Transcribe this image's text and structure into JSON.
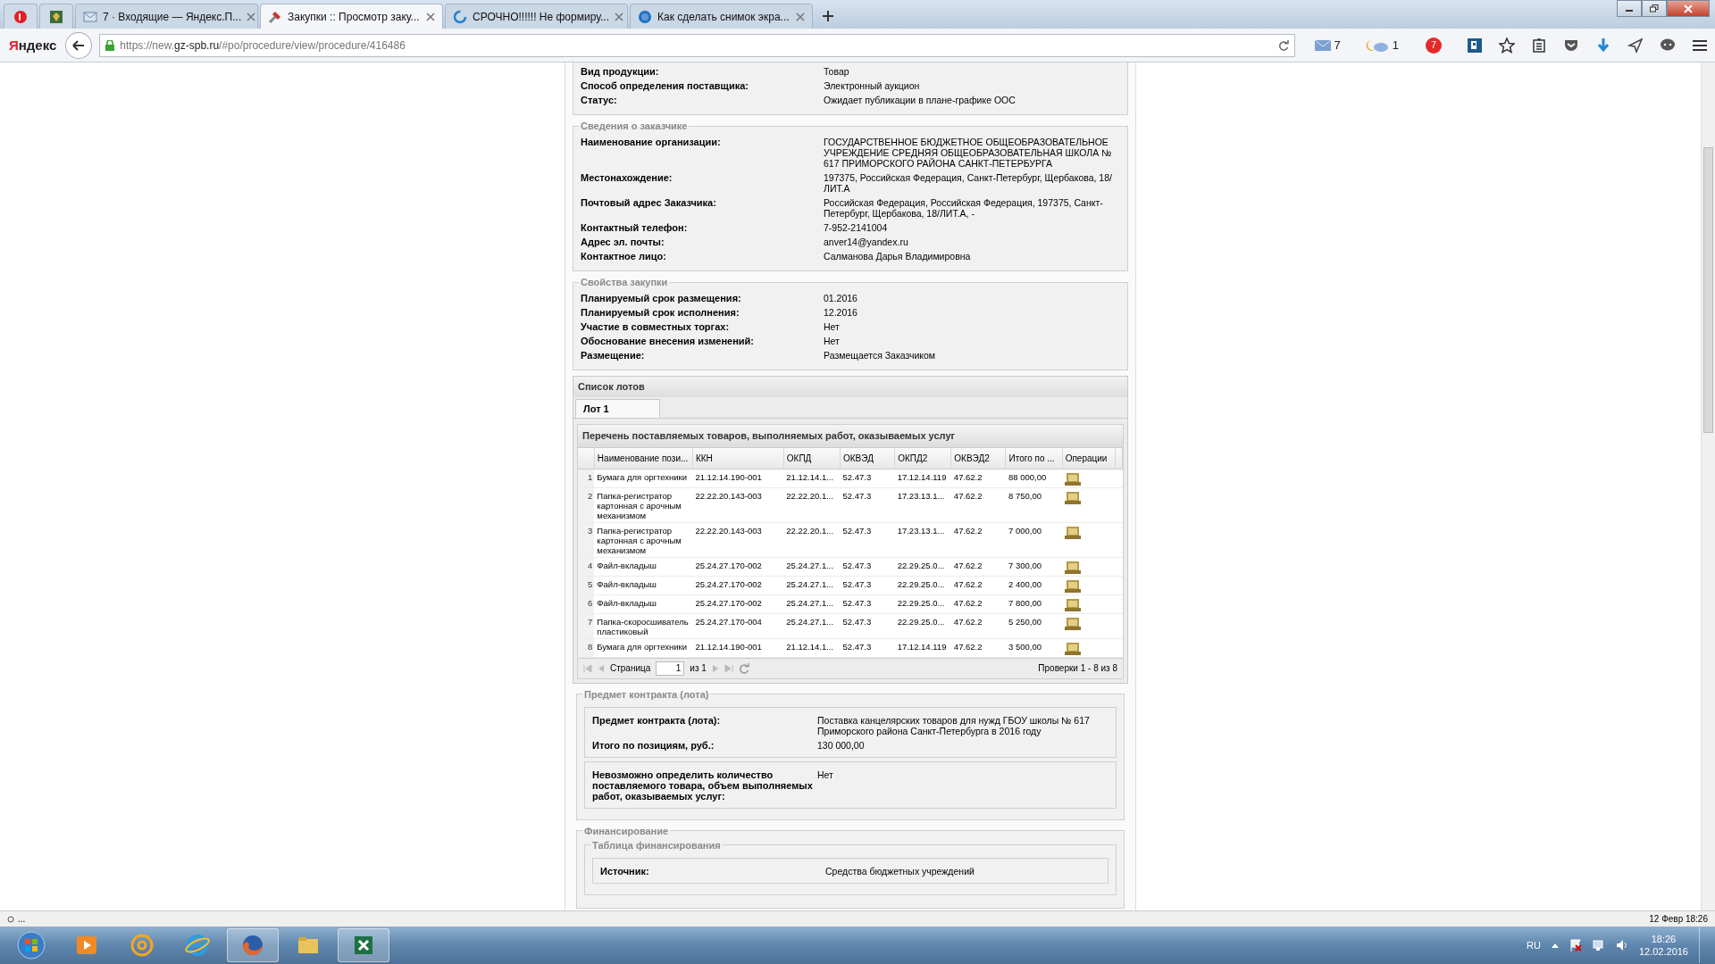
{
  "browser": {
    "tabs": [
      {
        "title": "7 · Входящие — Яндекс.П...",
        "selected": false
      },
      {
        "title": "Закупки :: Просмотр заку...",
        "selected": true
      },
      {
        "title": "СРОЧНО!!!!!! Не формиру...",
        "selected": false
      },
      {
        "title": "Как сделать снимок экра...",
        "selected": false
      }
    ],
    "logo": "Яндекс",
    "url_scheme": "https://new.",
    "url_domain": "gz-spb.ru",
    "url_path": "/#po/procedure/view/procedure/416486",
    "mail_count": "7",
    "weather_count": "1",
    "notify_badge": "7"
  },
  "procedure": {
    "rows": [
      {
        "label": "Вид продукции:",
        "value": "Товар"
      },
      {
        "label": "Способ определения поставщика:",
        "value": "Электронный аукцион"
      },
      {
        "label": "Статус:",
        "value": "Ожидает публикации в плане-графике ООС"
      }
    ]
  },
  "customer": {
    "legend": "Сведения о заказчике",
    "rows": [
      {
        "label": "Наименование организации:",
        "value": "ГОСУДАРСТВЕННОЕ БЮДЖЕТНОЕ ОБЩЕОБРАЗОВАТЕЛЬНОЕ УЧРЕЖДЕНИЕ СРЕДНЯЯ ОБЩЕОБРАЗОВАТЕЛЬНАЯ ШКОЛА № 617 ПРИМОРСКОГО РАЙОНА САНКТ-ПЕТЕРБУРГА"
      },
      {
        "label": "Местонахождение:",
        "value": "197375, Российская Федерация, Санкт-Петербург, Щербакова, 18/ЛИТ.А"
      },
      {
        "label": "Почтовый адрес Заказчика:",
        "value": "Российская Федерация, Российская Федерация, 197375, Санкт-Петербург, Щербакова, 18/ЛИТ.А, -"
      },
      {
        "label": "Контактный телефон:",
        "value": "7-952-2141004"
      },
      {
        "label": "Адрес эл. почты:",
        "value": "anver14@yandex.ru"
      },
      {
        "label": "Контактное лицо:",
        "value": "Салманова Дарья Владимировна"
      }
    ]
  },
  "properties": {
    "legend": "Свойства закупки",
    "rows": [
      {
        "label": "Планируемый срок размещения:",
        "value": "01.2016"
      },
      {
        "label": "Планируемый срок исполнения:",
        "value": "12.2016"
      },
      {
        "label": "Участие в совместных торгах:",
        "value": "Нет"
      },
      {
        "label": "Обоснование внесения изменений:",
        "value": "Нет"
      },
      {
        "label": "Размещение:",
        "value": "Размещается Заказчиком"
      }
    ]
  },
  "lots": {
    "title": "Список лотов",
    "tabs": [
      {
        "label": "Лот 1",
        "selected": true
      }
    ],
    "grid_title": "Перечень поставляемых товаров, выполняемых работ, оказываемых услуг",
    "columns": [
      "Наименование пози...",
      "ККН",
      "ОКПД",
      "ОКВЭД",
      "ОКПД2",
      "ОКВЭД2",
      "Итого по ...",
      "Операции"
    ],
    "rows": [
      {
        "number": "1",
        "cells": [
          "Бумага для оргтехники",
          "21.12.14.190-001",
          "21.12.14.1...",
          "52.47.3",
          "17.12.14.119",
          "47.62.2",
          "88 000,00"
        ]
      },
      {
        "number": "2",
        "cells": [
          "Папка-регистратор картонная с арочным механизмом",
          "22.22.20.143-003",
          "22.22.20.1...",
          "52.47.3",
          "17.23.13.1...",
          "47.62.2",
          "8 750,00"
        ]
      },
      {
        "number": "3",
        "cells": [
          "Папка-регистратор картонная с арочным механизмом",
          "22.22.20.143-003",
          "22.22.20.1...",
          "52.47.3",
          "17.23.13.1...",
          "47.62.2",
          "7 000,00"
        ]
      },
      {
        "number": "4",
        "cells": [
          "Файл-вкладыш",
          "25.24.27.170-002",
          "25.24.27.1...",
          "52.47.3",
          "22.29.25.0...",
          "47.62.2",
          "7 300,00"
        ]
      },
      {
        "number": "5",
        "cells": [
          "Файл-вкладыш",
          "25.24.27.170-002",
          "25.24.27.1...",
          "52.47.3",
          "22.29.25.0...",
          "47.62.2",
          "2 400,00"
        ]
      },
      {
        "number": "6",
        "cells": [
          "Файл-вкладыш",
          "25.24.27.170-002",
          "25.24.27.1...",
          "52.47.3",
          "22.29.25.0...",
          "47.62.2",
          "7 800,00"
        ]
      },
      {
        "number": "7",
        "cells": [
          "Папка-скоросшиватель пластиковый",
          "25.24.27.170-004",
          "25.24.27.1...",
          "52.47.3",
          "22.29.25.0...",
          "47.62.2",
          "5 250,00"
        ]
      },
      {
        "number": "8",
        "cells": [
          "Бумага для оргтехники",
          "21.12.14.190-001",
          "21.12.14.1...",
          "52.47.3",
          "17.12.14.119",
          "47.62.2",
          "3 500,00"
        ]
      }
    ],
    "pager": {
      "page_label": "Страница",
      "page": "1",
      "page_of": "из 1",
      "summary": "Проверки 1 - 8 из 8"
    }
  },
  "subject": {
    "legend": "Предмет контракта (лота)",
    "groups": [
      {
        "rows": [
          {
            "label": "Предмет контракта (лота):",
            "value": "Поставка канцелярских товаров для нужд ГБОУ школы № 617 Приморского района Санкт-Петербурга в 2016 году"
          },
          {
            "label": "Итого по позициям, руб.:",
            "value": "130 000,00"
          }
        ]
      },
      {
        "rows": [
          {
            "label": "Невозможно определить количество поставляемого товара, объем выполняемых работ, оказываемых услуг:",
            "value": "Нет"
          }
        ]
      }
    ]
  },
  "financing": {
    "legend": "Финансирование",
    "table": {
      "legend": "Таблица финансирования",
      "rows": [
        {
          "label": "Источник:",
          "value": "Средства бюджетных учреждений"
        }
      ]
    }
  },
  "status_bar": {
    "left": "...",
    "right": "12 Февр 18:26"
  },
  "taskbar": {
    "language": "RU",
    "time": "18:26",
    "date": "12.02.2016"
  }
}
